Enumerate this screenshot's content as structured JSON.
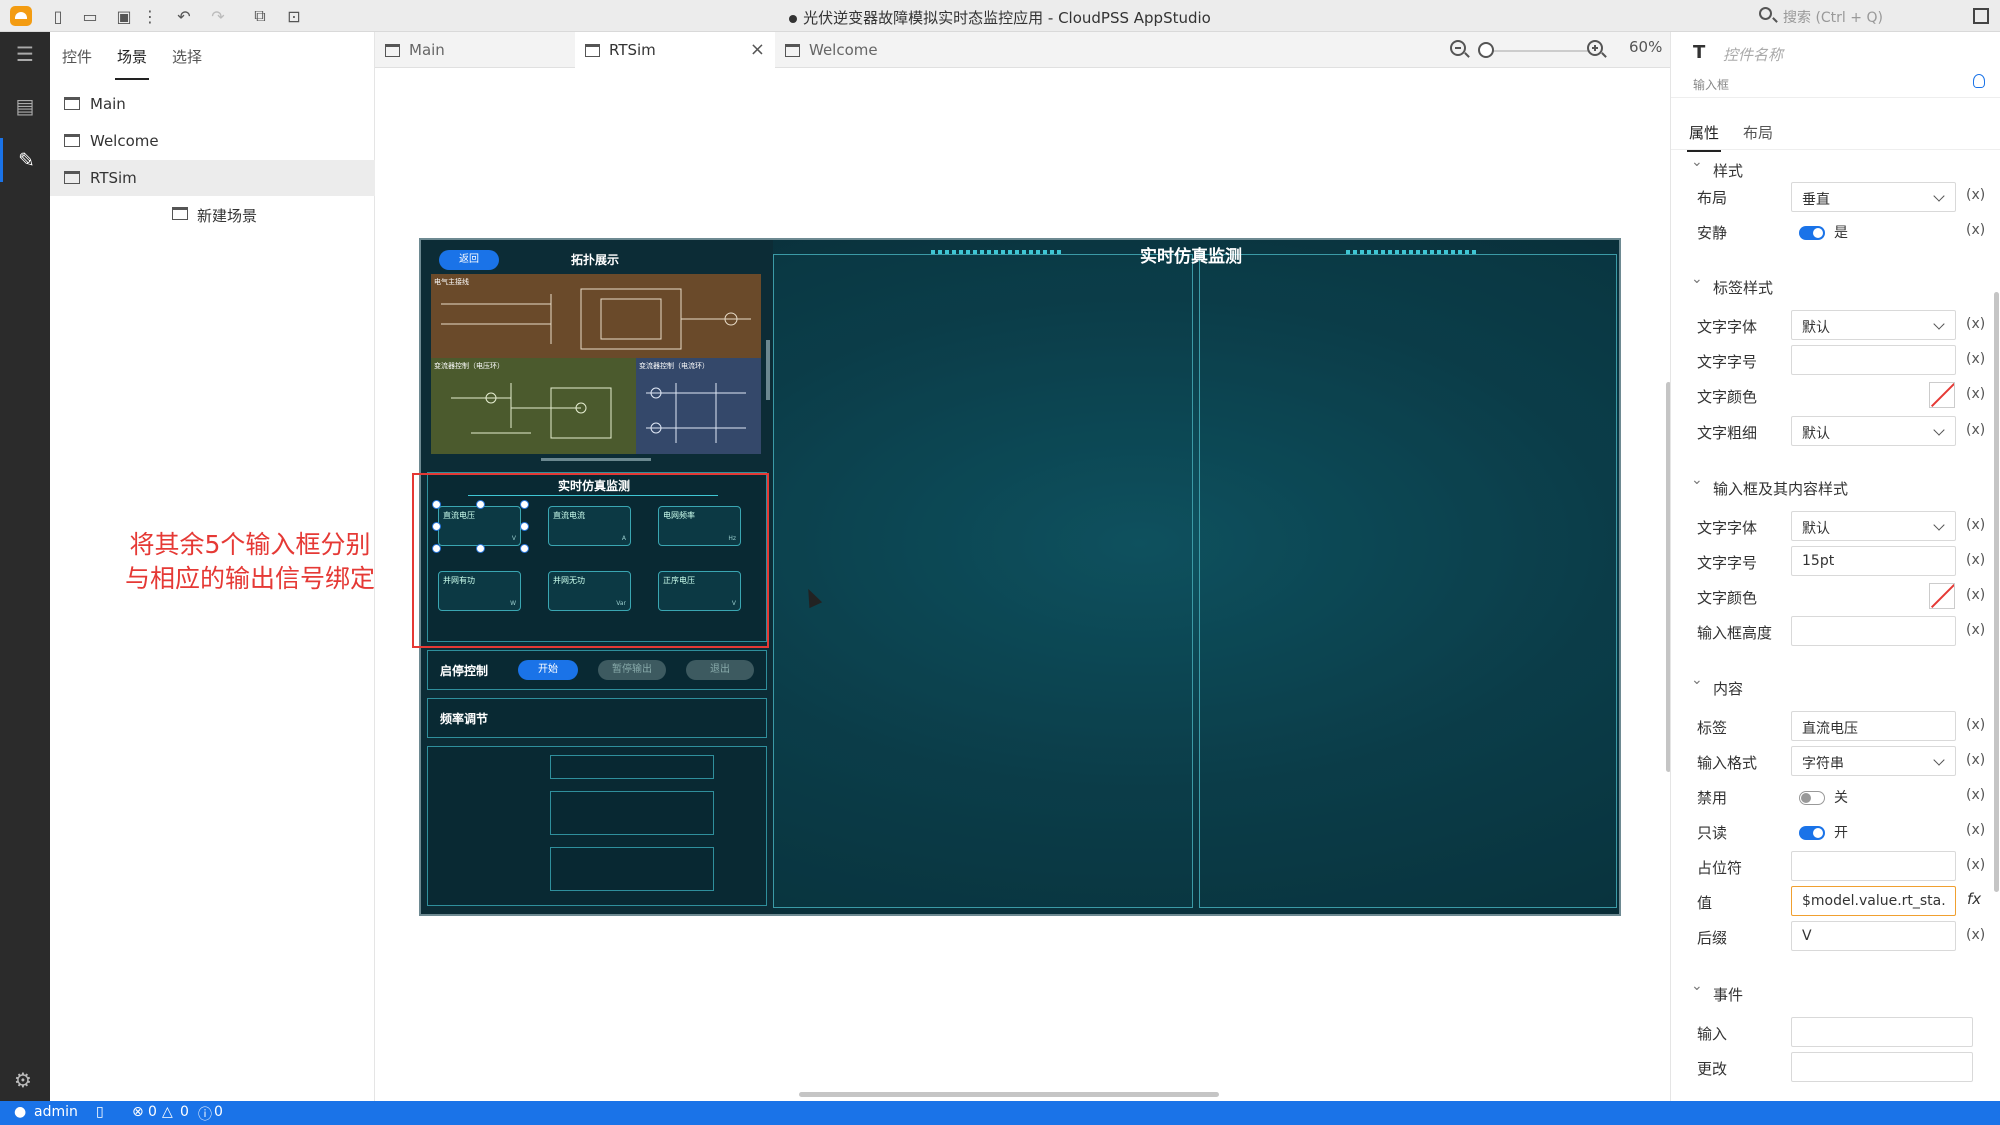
{
  "window": {
    "title": "光伏逆变器故障模拟实时态监控应用 - CloudPSS AppStudio",
    "search_placeholder": "搜索 (Ctrl + Q)"
  },
  "left_panel": {
    "tabs": [
      "控件",
      "场景",
      "选择"
    ],
    "active_tab": "场景",
    "scenes": [
      "Main",
      "Welcome",
      "RTSim"
    ],
    "selected_scene": "RTSim",
    "new_scene": "新建场景"
  },
  "editor": {
    "tabs": [
      {
        "label": "Main",
        "active": false
      },
      {
        "label": "RTSim",
        "active": true
      },
      {
        "label": "Welcome",
        "active": false
      }
    ],
    "close_symbol": "×",
    "zoom_level": "60%"
  },
  "canvas": {
    "main_title": "实时仿真监测",
    "topology_title": "拓扑展示",
    "back_label": "返回",
    "diagram_labels": [
      "电气主接线",
      "变流器控制（电压环）",
      "变流器控制（电流环）"
    ],
    "monitor_title": "实时仿真监测",
    "inputs": [
      {
        "label": "直流电压",
        "unit": "V"
      },
      {
        "label": "直流电流",
        "unit": "A"
      },
      {
        "label": "电网频率",
        "unit": "Hz"
      },
      {
        "label": "并网有功",
        "unit": "W"
      },
      {
        "label": "并网无功",
        "unit": "Var"
      },
      {
        "label": "正序电压",
        "unit": "V"
      }
    ],
    "control_title": "启停控制",
    "start_label": "开始",
    "pause_label": "暂停输出",
    "stop_label": "退出",
    "freq_title": "频率调节"
  },
  "annotation": {
    "line1": "将其余5个输入框分别",
    "line2": "与相应的输出信号绑定"
  },
  "properties": {
    "name_placeholder": "控件名称",
    "component_type": "输入框",
    "tabs": [
      "属性",
      "布局"
    ],
    "x_label": "(x)",
    "fx_label": "fx",
    "style": {
      "section": "样式",
      "layout_label": "布局",
      "layout_value": "垂直",
      "quiet_label": "安静",
      "quiet_value": "是"
    },
    "label_style": {
      "section": "标签样式",
      "font_label": "文字字体",
      "font_value": "默认",
      "size_label": "文字字号",
      "size_value": "",
      "color_label": "文字颜色",
      "weight_label": "文字粗细",
      "weight_value": "默认"
    },
    "input_style": {
      "section": "输入框及其内容样式",
      "font_label": "文字字体",
      "font_value": "默认",
      "size_label": "文字字号",
      "size_value": "15pt",
      "color_label": "文字颜色",
      "height_label": "输入框高度",
      "height_value": ""
    },
    "content": {
      "section": "内容",
      "label_label": "标签",
      "label_value": "直流电压",
      "format_label": "输入格式",
      "format_value": "字符串",
      "disabled_label": "禁用",
      "disabled_value": "关",
      "readonly_label": "只读",
      "readonly_value": "开",
      "placeholder_label": "占位符",
      "placeholder_value": "",
      "value_label": "值",
      "value_value": "$model.value.rt_sta...",
      "suffix_label": "后缀",
      "suffix_value": "V"
    },
    "events": {
      "section": "事件",
      "input_label": "输入",
      "input_value": "",
      "change_label": "更改",
      "change_value": ""
    }
  },
  "status_bar": {
    "user": "admin",
    "errors": "0",
    "warnings": "0",
    "infos": "0"
  },
  "colors": {
    "accent": "#1a73e8",
    "annotation": "#e53935",
    "canvas_bg": "#0b3a46"
  }
}
